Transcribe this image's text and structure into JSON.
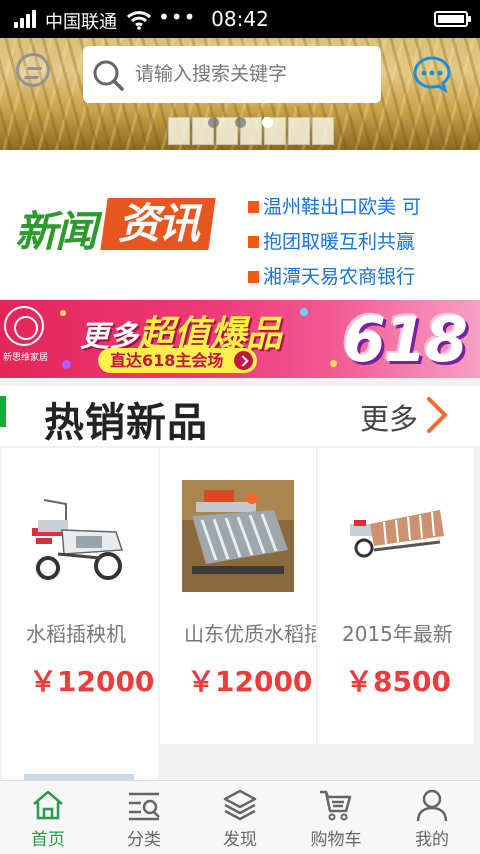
{
  "status_bar": {
    "carrier": "中国联通",
    "more": "•••",
    "time": "08:42"
  },
  "header": {
    "search_placeholder": "请输入搜索关键字",
    "carousel_slides": 3,
    "carousel_active_index": 2
  },
  "news": {
    "logo_part1": "新闻",
    "logo_part2": "资讯",
    "items": [
      "温州鞋出口欧美 可",
      "抱团取暖互利共赢",
      "湘潭天易农商银行"
    ]
  },
  "promo": {
    "brand_name": "新思维家居",
    "headline_prefix": "更多",
    "headline_highlight": "超值爆品",
    "cta": "直达618主会场",
    "big_text": "618"
  },
  "hot_section": {
    "title": "热销新品",
    "more": "更多"
  },
  "products": [
    {
      "name": "水稻插秧机",
      "price": "￥12000"
    },
    {
      "name": "山东优质水稻插秧机",
      "price": "￥12000"
    },
    {
      "name": "2015年最新",
      "price": "￥8500"
    }
  ],
  "tabbar": [
    {
      "label": "首页",
      "icon": "home-icon",
      "active": true
    },
    {
      "label": "分类",
      "icon": "category-icon",
      "active": false
    },
    {
      "label": "发现",
      "icon": "layers-icon",
      "active": false
    },
    {
      "label": "购物车",
      "icon": "cart-icon",
      "active": false
    },
    {
      "label": "我的",
      "icon": "user-icon",
      "active": false
    }
  ],
  "colors": {
    "accent_green": "#2a9a4a",
    "price_red": "#ee3b3b",
    "news_blue": "#1a73d6",
    "bullet_orange": "#f05a11",
    "more_orange": "#f26b2a"
  }
}
